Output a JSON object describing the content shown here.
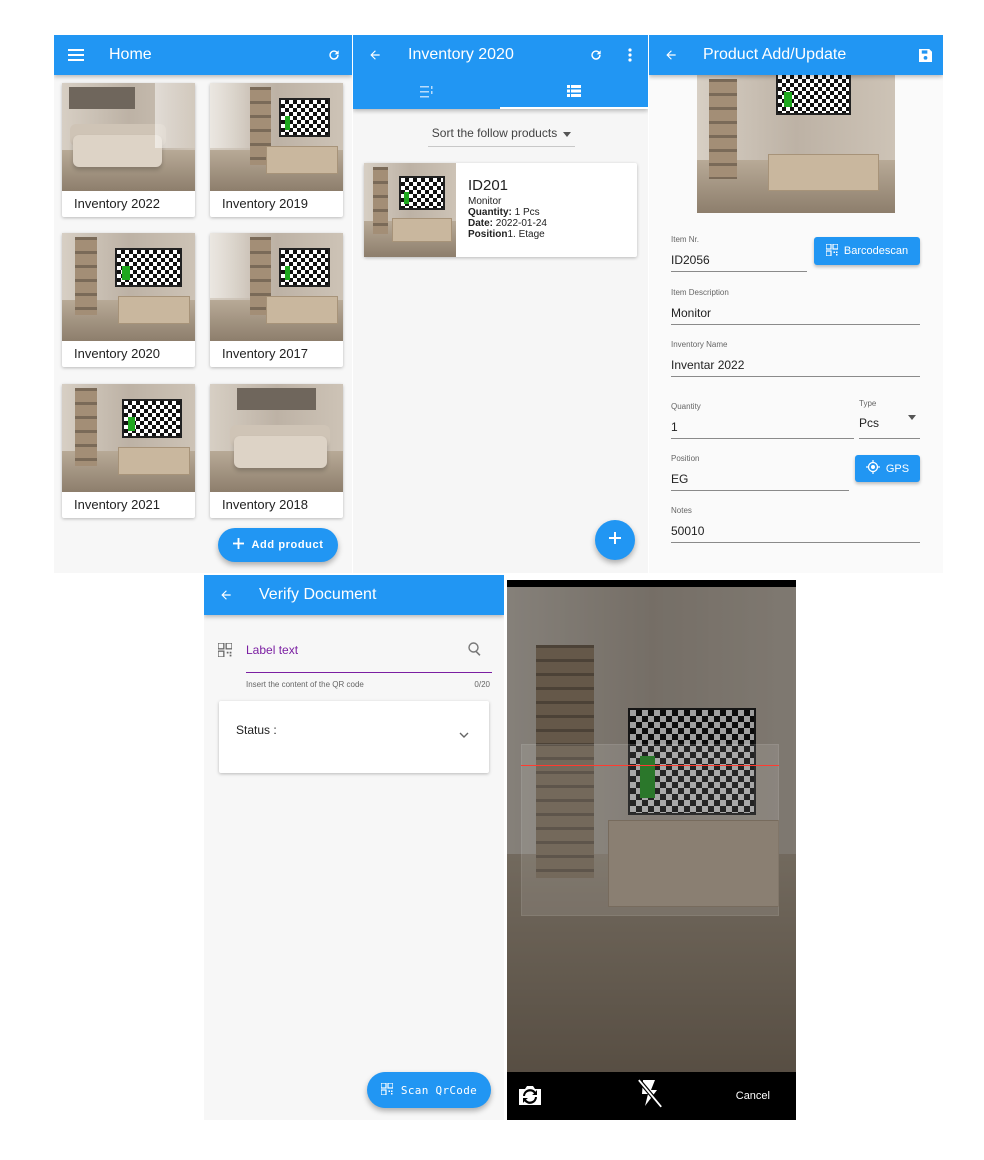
{
  "home": {
    "title": "Home",
    "cards": [
      {
        "label": "Inventory 2022",
        "image": "sofa"
      },
      {
        "label": "Inventory 2019",
        "image": "tv"
      },
      {
        "label": "Inventory 2020",
        "image": "tv"
      },
      {
        "label": "Inventory 2017",
        "image": "tv"
      },
      {
        "label": "Inventory 2021",
        "image": "tv"
      },
      {
        "label": "Inventory 2018",
        "image": "sofa"
      }
    ],
    "add_button": "Add product",
    "icons": {
      "menu": "menu-icon",
      "refresh": "refresh-icon",
      "add": "plus-icon"
    }
  },
  "inventory": {
    "title": "Inventory 2020",
    "sort_label": "Sort the follow products",
    "product": {
      "id": "ID201",
      "name": "Monitor",
      "quantity_label": "Quantity:",
      "quantity_value": " 1 Pcs",
      "date_label": "Date:",
      "date_value": " 2022-01-24",
      "position_label": "Position",
      "position_value": "1. Etage"
    },
    "icons": {
      "back": "arrow-left-icon",
      "refresh": "refresh-icon",
      "more": "more-vert-icon",
      "tab_a": "list-detail-icon",
      "tab_b": "list-icon",
      "sort": "caret-down-icon",
      "add": "plus-icon"
    }
  },
  "product_form": {
    "title": "Product Add/Update",
    "item_nr_label": "Item Nr.",
    "item_nr_value": "ID2056",
    "barcode_button": "Barcodescan",
    "desc_label": "Item Description",
    "desc_value": "Monitor",
    "inv_label": "Inventory Name",
    "inv_value": "Inventar 2022",
    "qty_label": "Quantity",
    "qty_value": "1",
    "type_label": "Type",
    "type_value": "Pcs",
    "pos_label": "Position",
    "pos_value": "EG",
    "gps_button": "GPS",
    "notes_label": "Notes",
    "notes_value": "50010",
    "icons": {
      "back": "arrow-left-icon",
      "save": "save-icon",
      "qr": "qr-code-icon",
      "gps": "gps-icon",
      "dropdown": "caret-down-icon"
    }
  },
  "verify": {
    "title": "Verify Document",
    "input_value": "Label text",
    "helper_text": "Insert the content of the QR code",
    "counter": "0/20",
    "status_label": "Status :",
    "scan_button": "Scan QrCode",
    "accent_color": "#7b1fa2",
    "icons": {
      "back": "arrow-left-icon",
      "qr": "qr-code-icon",
      "search": "search-icon",
      "expand": "chevron-down-icon"
    }
  },
  "scanner": {
    "cancel_label": "Cancel",
    "scan_line_color": "#ff3b30",
    "icons": {
      "switch": "camera-switch-icon",
      "flash": "flash-off-icon"
    }
  }
}
